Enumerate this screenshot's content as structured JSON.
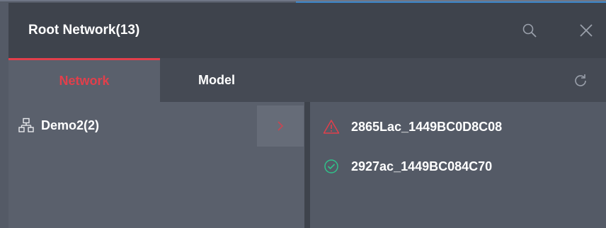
{
  "header": {
    "title": "Root Network(13)"
  },
  "tabs": [
    {
      "label": "Network",
      "active": true
    },
    {
      "label": "Model",
      "active": false
    }
  ],
  "tree": {
    "items": [
      {
        "label": "Demo2(2)",
        "icon": "network-icon"
      }
    ]
  },
  "devices": [
    {
      "label": "2865Lac_1449BC0D8C08",
      "status": "warning",
      "icon": "warning-icon"
    },
    {
      "label": "2927ac_1449BC084C70",
      "status": "ok",
      "icon": "check-circle-icon"
    }
  ],
  "colors": {
    "accent": "#e23f4b",
    "ok": "#2fc28a",
    "warning": "#e23f4b",
    "header_bg": "#3e434c"
  }
}
